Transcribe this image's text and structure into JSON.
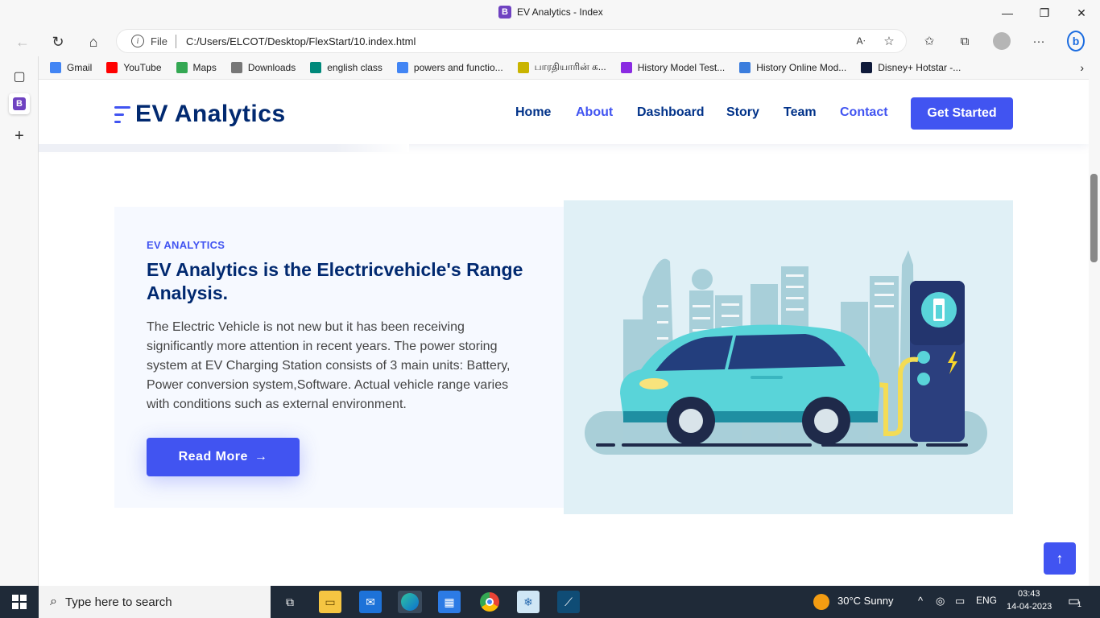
{
  "window": {
    "title": "EV Analytics - Index"
  },
  "browser": {
    "address_file_label": "File",
    "url": "C:/Users/ELCOT/Desktop/FlexStart/10.index.html"
  },
  "bookmarks": [
    {
      "label": "Gmail",
      "icon": "google-icon",
      "color": "#4285f4"
    },
    {
      "label": "YouTube",
      "icon": "youtube-icon",
      "color": "#ff0000"
    },
    {
      "label": "Maps",
      "icon": "maps-icon",
      "color": "#34a853"
    },
    {
      "label": "Downloads",
      "icon": "page-icon",
      "color": "#777777"
    },
    {
      "label": "english class",
      "icon": "meet-icon",
      "color": "#00897b"
    },
    {
      "label": "powers and functio...",
      "icon": "google-icon",
      "color": "#4285f4"
    },
    {
      "label": "பாரதியாரின் க...",
      "icon": "site-icon",
      "color": "#c9b400"
    },
    {
      "label": "History Model Test...",
      "icon": "testbook-icon",
      "color": "#8a2be2"
    },
    {
      "label": "History Online Mod...",
      "icon": "star-icon",
      "color": "#3b7ddd"
    },
    {
      "label": "Disney+ Hotstar -...",
      "icon": "hotstar-icon",
      "color": "#0f1a3a"
    }
  ],
  "site": {
    "brand": "EV Analytics",
    "nav": [
      "Home",
      "About",
      "Dashboard",
      "Story",
      "Team",
      "Contact"
    ],
    "cta": "Get Started"
  },
  "about": {
    "eyebrow": "EV ANALYTICS",
    "heading": "EV Analytics is the Electricvehicle's Range Analysis.",
    "paragraph": "The Electric Vehicle is not new but it has been receiving significantly more attention in recent years. The power storing system at EV Charging Station consists of 3 main units: Battery, Power conversion system,Software. Actual vehicle range varies with conditions such as external environment.",
    "button": "Read More",
    "button_arrow": "→"
  },
  "back_to_top": "↑",
  "taskbar": {
    "search_placeholder": "Type here to search",
    "weather": "30°C  Sunny",
    "lang": "ENG",
    "time": "03:43",
    "date": "14-04-2023",
    "notification_count": "1"
  },
  "colors": {
    "accent": "#4154f1",
    "navy": "#012970",
    "about_bg": "#f6f9ff",
    "illustration_bg": "#e0f0f6"
  }
}
